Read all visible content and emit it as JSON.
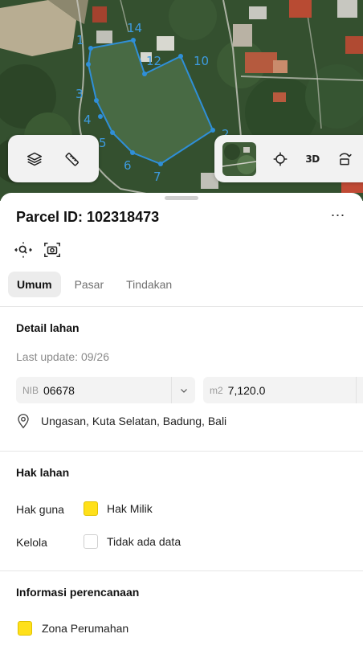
{
  "map": {
    "vertex_labels": [
      "1",
      "2",
      "3",
      "4",
      "5",
      "6",
      "7",
      "10",
      "12",
      "14"
    ],
    "button_3d_label": "3D",
    "boundary_color": "#2f8fd8",
    "icons": [
      "layers-icon",
      "ruler-icon",
      "satellite-thumbnail",
      "crosshair-icon",
      "rotate-icon"
    ]
  },
  "sheet": {
    "title": "Parcel ID: 102318473",
    "more_icon": "⋯",
    "tabs": [
      {
        "label": "Umum",
        "active": true
      },
      {
        "label": "Pasar",
        "active": false
      },
      {
        "label": "Tindakan",
        "active": false
      }
    ],
    "detail": {
      "heading": "Detail lahan",
      "last_update": "Last update: 09/26",
      "nib_label": "NIB",
      "nib_value": "06678",
      "area_label": "m2",
      "area_value": "7,120.0",
      "location": "Ungasan, Kuta Selatan, Badung, Bali"
    },
    "rights": {
      "heading": "Hak lahan",
      "rows": [
        {
          "label": "Hak guna",
          "value": "Hak Milik",
          "swatch": "#ffe01a"
        },
        {
          "label": "Kelola",
          "value": "Tidak ada data",
          "swatch": "#ffffff"
        }
      ]
    },
    "planning": {
      "heading": "Informasi perencanaan",
      "zone": "Zona Perumahan",
      "zone_color": "#ffe01a"
    }
  }
}
